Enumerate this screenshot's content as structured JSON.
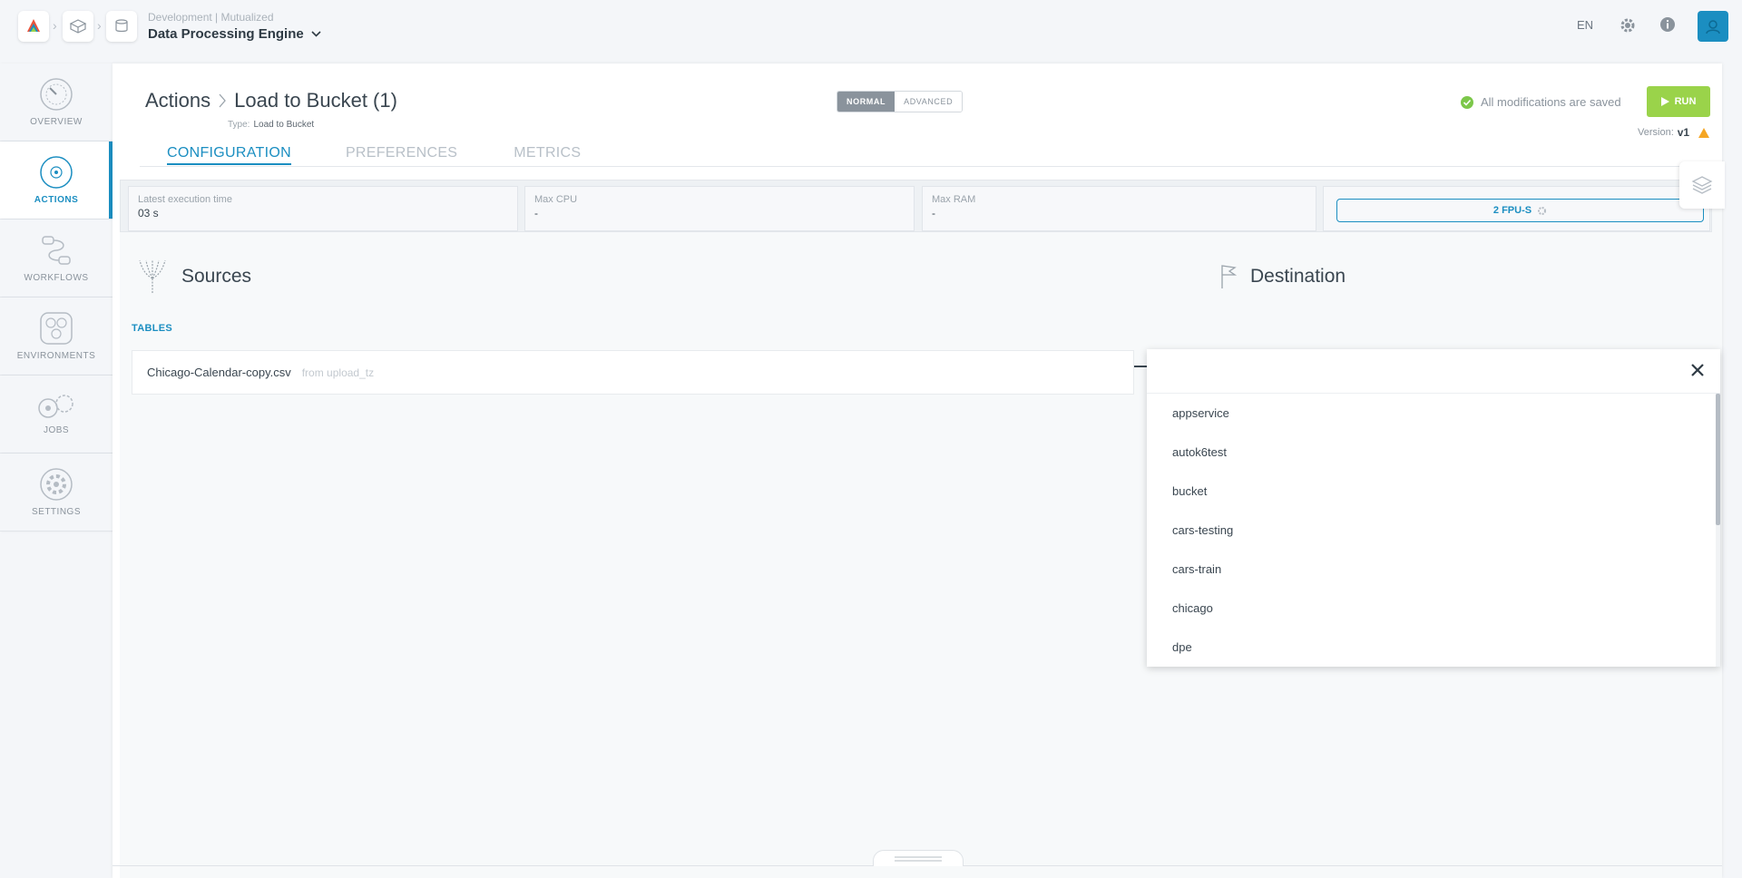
{
  "header": {
    "project_path": "Development | Mutualized",
    "project_name": "Data Processing Engine",
    "language": "EN"
  },
  "nav": {
    "items": [
      {
        "label": "OVERVIEW",
        "icon": "overview-gauge-icon"
      },
      {
        "label": "ACTIONS",
        "icon": "actions-target-icon"
      },
      {
        "label": "WORKFLOWS",
        "icon": "workflows-icon"
      },
      {
        "label": "ENVIRONMENTS",
        "icon": "environments-icon"
      },
      {
        "label": "JOBS",
        "icon": "jobs-icon"
      },
      {
        "label": "SETTINGS",
        "icon": "settings-icon"
      }
    ],
    "active": "ACTIONS"
  },
  "page": {
    "breadcrumb_root": "Actions",
    "title": "Load to Bucket (1)",
    "type_label": "Type:",
    "type_value": "Load to Bucket",
    "mode_normal": "NORMAL",
    "mode_advanced": "ADVANCED",
    "saved_status": "All modifications are saved",
    "run_label": "RUN",
    "version_label": "Version:",
    "version_value": "v1"
  },
  "tabs": [
    "CONFIGURATION",
    "PREFERENCES",
    "METRICS"
  ],
  "metrics": {
    "exec_label": "Latest execution time",
    "exec_value": "03 s",
    "cpu_label": "Max CPU",
    "cpu_value": "-",
    "ram_label": "Max RAM",
    "ram_value": "-",
    "fpu_label": "2 FPU-S"
  },
  "sources": {
    "title": "Sources",
    "tables_label": "TABLES",
    "table_name": "Chicago-Calendar-copy.csv",
    "table_from": "from upload_tz"
  },
  "destination": {
    "title": "Destination",
    "options": [
      "appservice",
      "autok6test",
      "bucket",
      "cars-testing",
      "cars-train",
      "chicago",
      "dpe"
    ]
  },
  "colors": {
    "accent": "#1b8ec1",
    "run": "#9ad34a",
    "saved_check": "#7cc74a",
    "warning": "#f5a623"
  }
}
